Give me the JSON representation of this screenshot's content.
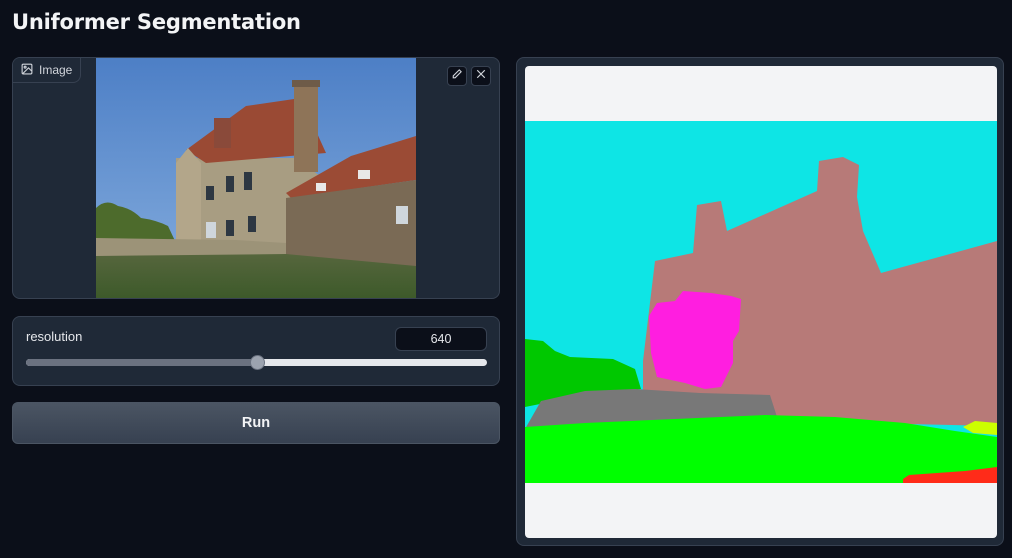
{
  "app": {
    "title": "Uniformer Segmentation"
  },
  "input_image": {
    "label": "Image",
    "icon": "image-icon"
  },
  "toolbar": {
    "edit_icon": "pencil-icon",
    "clear_icon": "close-icon"
  },
  "slider": {
    "label": "resolution",
    "value": "640",
    "fraction": 0.5
  },
  "run_button": {
    "label": "Run"
  },
  "colors": {
    "background": "#0b0f19",
    "panel": "#1f2937",
    "sky_segment": "#0ee5e5",
    "building_segment": "#b77a78",
    "window_segment": "#ff1ee0",
    "tree_segment": "#00c800",
    "grass_segment": "#00ff00",
    "wall_segment": "#787878",
    "plant_segment": "#ccff00",
    "road_segment": "#ff2b19"
  }
}
